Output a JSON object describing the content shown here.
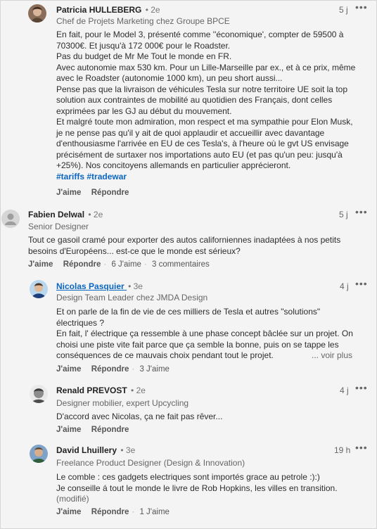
{
  "comments": [
    {
      "name": "Patricia HULLEBERG",
      "degree": "• 2e",
      "headline": "Chef de Projets Marketing chez Groupe BPCE",
      "time": "5 j",
      "body": [
        "En fait, pour le Model 3, présenté comme ''économique', compter de 59500 à",
        "70300€. Et jusqu'à 172 000€ pour le Roadster.",
        "Pas du budget de Mr Me Tout le monde en FR.",
        "Avec autonomie max 530 km. Pour un Lille-Marseille par ex., et à ce prix, même",
        "avec le Roadster (autonomie 1000 km), un peu short aussi...",
        "Pense pas que la livraison de véhicules Tesla sur notre territoire UE soit la top",
        "solution aux contraintes de mobilité au quotidien des Français, dont celles",
        "exprimées par les GJ au début du mouvement.",
        "Et malgré toute mon admiration, mon respect et ma sympathie pour Elon Musk,",
        "je ne pense pas qu'il y ait de quoi applaudir et accueillir avec davantage",
        "d'enthousiasme l'arrivée en EU de ces Tesla's, à l'heure où le gvt US envisage",
        "précisément de surtaxer nos importations auto EU (et pas qu'un peu: jusqu'à",
        "+25%). Nos concitoyens allemands en particulier apprécieront."
      ],
      "tags": "#tariffs #tradewar",
      "like": "J'aime",
      "reply": "Répondre"
    },
    {
      "name": "Fabien Delwal",
      "degree": "• 2e",
      "headline": "Senior Designer",
      "time": "5 j",
      "body": [
        "Tout ce gasoil cramé pour exporter des autos californiennes inadaptées à nos petits",
        "besoins d'Européens... est-ce que le monde est sérieux?"
      ],
      "like": "J'aime",
      "reply": "Répondre",
      "likes_count": "6 J'aime",
      "comments_count": "3 commentaires"
    },
    {
      "name": "Nicolas Pasquier",
      "degree": "• 3e",
      "headline": "Design Team Leader chez JMDA Design",
      "time": "4 j",
      "body": [
        "Et on parle de la fin de vie de ces milliers de Tesla et autres \"solutions\"",
        "électriques ?",
        "En fait, l' électrique ça ressemble à une phase concept bâclée sur un projet. On",
        "choisi une piste vite fait parce que ça semble la bonne, puis on se tappe les",
        "conséquences de ce mauvais choix pendant tout le projet."
      ],
      "see_more": "... voir plus",
      "like": "J'aime",
      "reply": "Répondre",
      "likes_count": "3 J'aime"
    },
    {
      "name": "Renald PREVOST",
      "degree": "• 2e",
      "headline": "Designer mobilier, expert Upcycling",
      "time": "4 j",
      "body": [
        "D'accord avec Nicolas, ça ne fait pas rêver..."
      ],
      "like": "J'aime",
      "reply": "Répondre"
    },
    {
      "name": "David Lhuillery",
      "degree": "• 3e",
      "headline": "Freelance Product Designer (Design & Innovation)",
      "time": "19 h",
      "body": [
        "Le comble : ces gadgets electriques sont importés grace au petrole :):)",
        "Je conseille á tout le monde le livre de Rob Hopkins, les villes en transition.",
        "(modifié)"
      ],
      "like": "J'aime",
      "reply": "Répondre",
      "likes_count": "1 J'aime"
    }
  ],
  "icons": {
    "more": "more-horizontal-icon",
    "avatar_placeholder": "person-silhouette-icon"
  },
  "colors": {
    "link": "#0a66c2",
    "background": "#f3f3f3"
  }
}
